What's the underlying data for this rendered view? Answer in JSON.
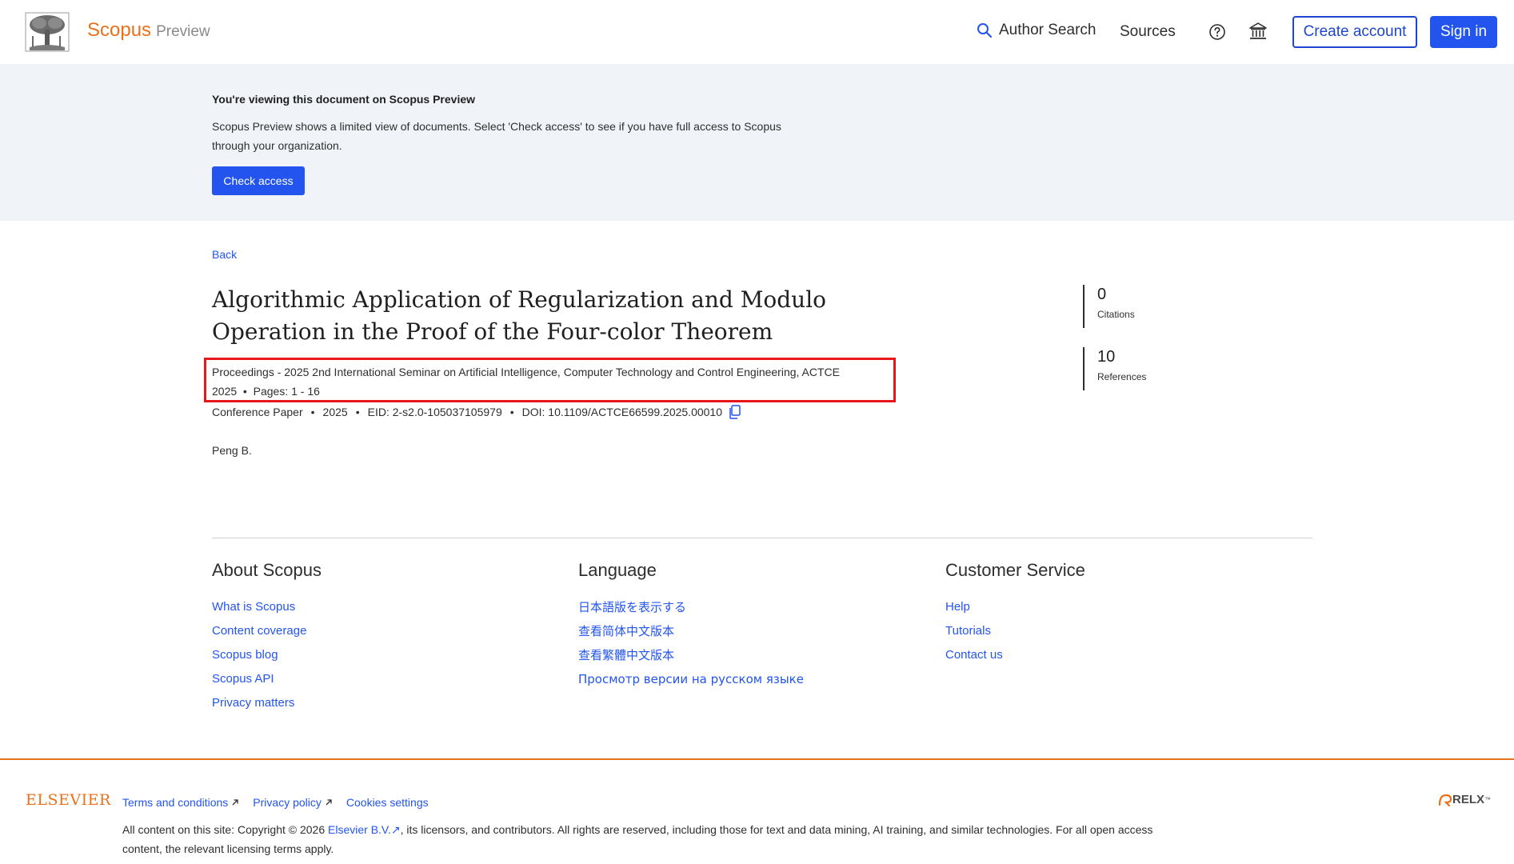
{
  "header": {
    "brand": "Scopus",
    "brand_sub": "Preview",
    "author_search": "Author Search",
    "sources": "Sources",
    "create_account": "Create account",
    "sign_in": "Sign in"
  },
  "banner": {
    "title": "You're viewing this document on Scopus Preview",
    "text": "Scopus Preview shows a limited view of documents. Select 'Check access' to see if you have full access to Scopus through your organization.",
    "check_access": "Check access"
  },
  "document": {
    "back": "Back",
    "title": "Algorithmic Application of Regularization and Modulo Operation in the Proof of the Four-color Theorem",
    "source": "Proceedings - 2025 2nd International Seminar on Artificial Intelligence, Computer Technology and Control Engineering, ACTCE 2025",
    "pages": "Pages: 1 - 16",
    "doc_type": "Conference Paper",
    "year": "2025",
    "eid": "EID: 2-s2.0-105037105979",
    "doi": "DOI: 10.1109/ACTCE66599.2025.00010",
    "author": "Peng B."
  },
  "metrics": {
    "citations_value": "0",
    "citations_label": "Citations",
    "references_value": "10",
    "references_label": "References"
  },
  "footer": {
    "about": {
      "heading": "About Scopus",
      "links": [
        "What is Scopus",
        "Content coverage",
        "Scopus blog",
        "Scopus API",
        "Privacy matters"
      ]
    },
    "language": {
      "heading": "Language",
      "links": [
        "日本語版を表示する",
        "查看简体中文版本",
        "查看繁體中文版本",
        "Просмотр версии на русском языке"
      ]
    },
    "customer": {
      "heading": "Customer Service",
      "links": [
        "Help",
        "Tutorials",
        "Contact us"
      ]
    },
    "elsevier": "ELSEVIER",
    "terms": "Terms and conditions",
    "privacy": "Privacy policy",
    "cookies": "Cookies settings",
    "copyright_pre": "All content on this site: Copyright © 2026",
    "copyright_link": "Elsevier B.V.",
    "copyright_post": ", its licensors, and contributors. All rights are reserved, including those for text and data mining, AI training, and similar technologies. For all open access content, the relevant licensing terms apply.",
    "relx": "RELX",
    "relx_tm": "™"
  },
  "colors": {
    "accent_orange": "#e9711c",
    "primary_blue": "#2354ee",
    "highlight_red": "#e8151b",
    "banner_bg": "#f0f4f8"
  }
}
